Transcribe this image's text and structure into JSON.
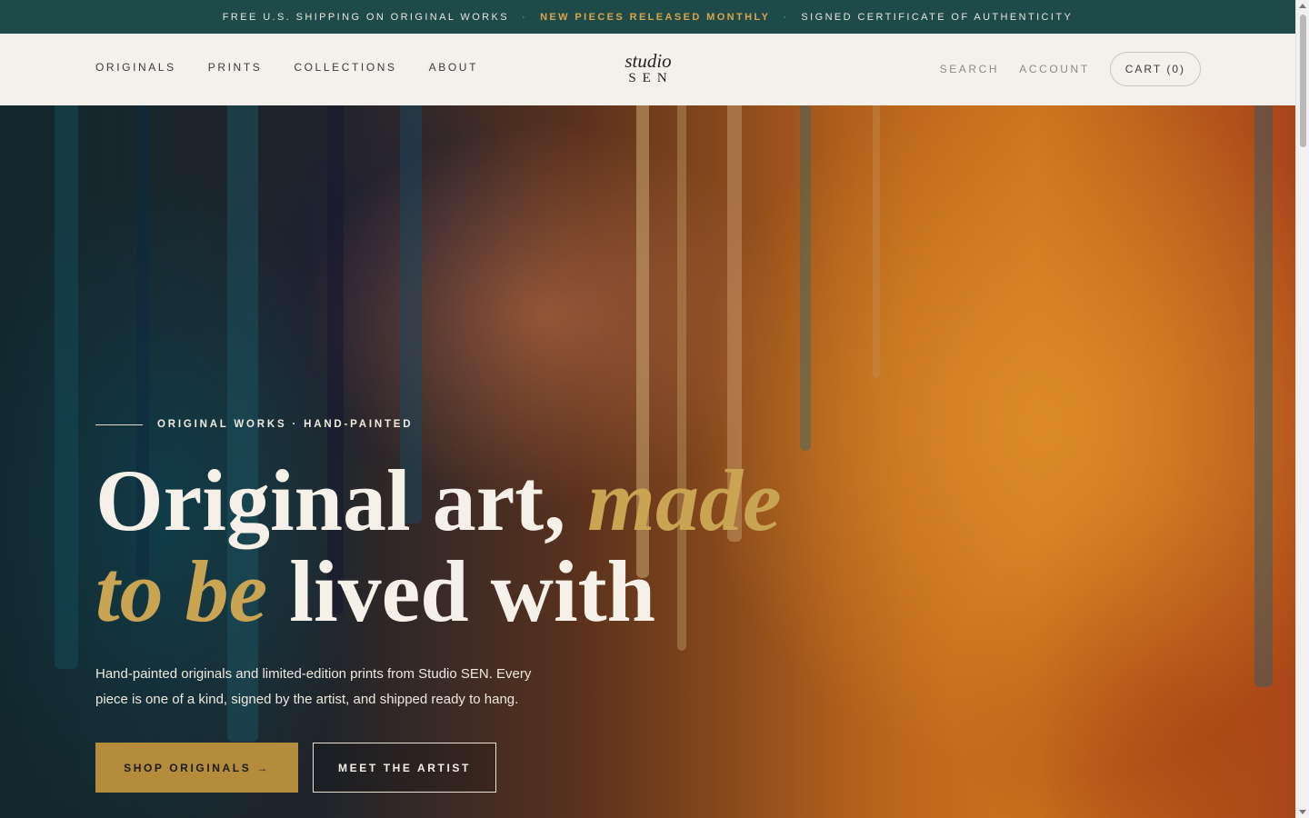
{
  "announcement": {
    "item1": "FREE U.S. SHIPPING ON ORIGINAL WORKS",
    "item2": "NEW PIECES RELEASED MONTHLY",
    "item3": "SIGNED CERTIFICATE OF AUTHENTICITY",
    "separator": "·"
  },
  "header": {
    "nav": [
      "ORIGINALS",
      "PRINTS",
      "COLLECTIONS",
      "ABOUT"
    ],
    "logo_line1": "studio",
    "logo_line2": "SEN",
    "search": "SEARCH",
    "account": "ACCOUNT",
    "cart": "CART (0)"
  },
  "hero": {
    "eyebrow": "ORIGINAL WORKS · HAND-PAINTED",
    "headline_part1": "Original art, ",
    "headline_italic1": "made",
    "headline_italic2": "to be",
    "headline_part2": " lived with",
    "subcopy": "Hand-painted originals and limited-edition prints from Studio SEN. Every piece is one of a kind, signed by the artist, and shipped ready to hang.",
    "primary_cta": "SHOP ORIGINALS →",
    "secondary_cta": "MEET THE ARTIST"
  },
  "colors": {
    "announcement_bg": "#1f4a4a",
    "accent_gold": "#c9a452",
    "button_gold": "#b58b3c",
    "header_bg": "#f4f1ec"
  }
}
